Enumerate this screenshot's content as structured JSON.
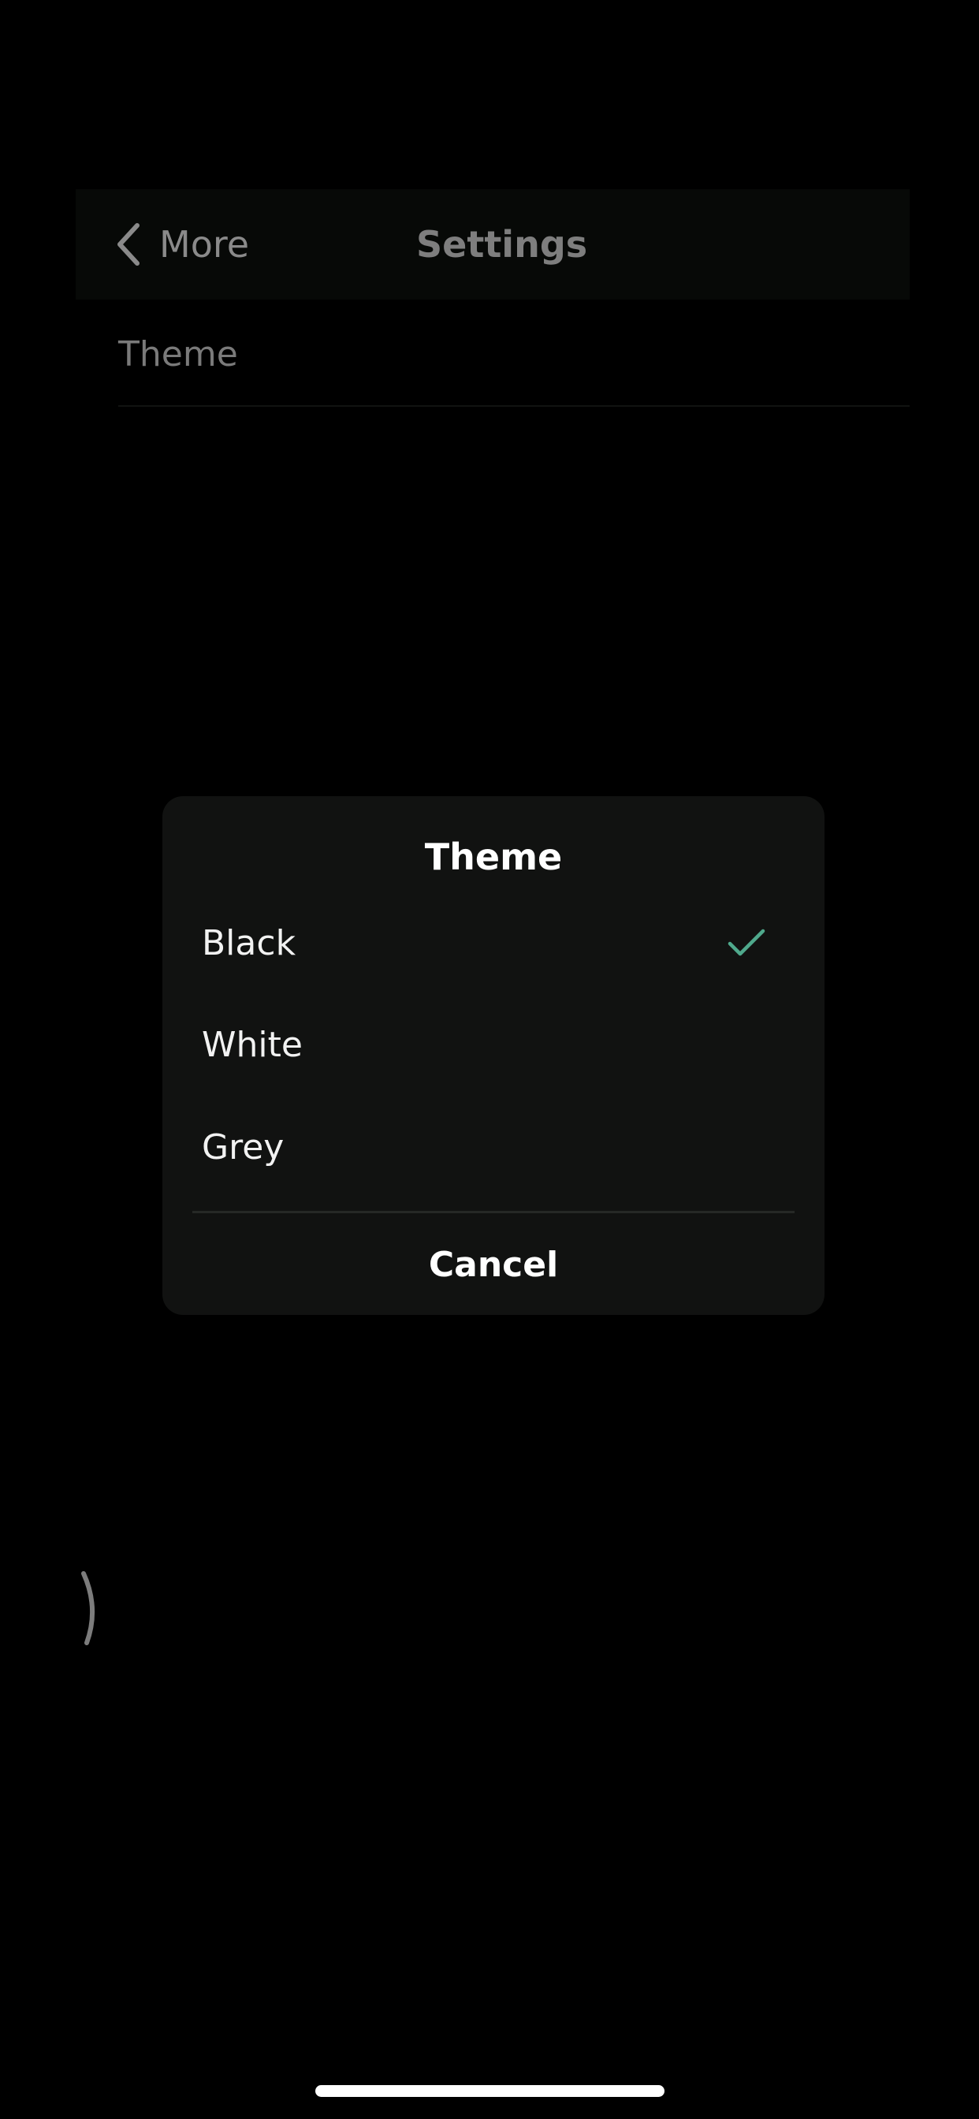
{
  "navbar": {
    "back_label": "More",
    "title": "Settings",
    "back_icon": "chevron-left-icon"
  },
  "settings": {
    "rows": [
      {
        "label": "Theme"
      }
    ]
  },
  "dialog": {
    "title": "Theme",
    "options": [
      {
        "label": "Black",
        "selected": true
      },
      {
        "label": "White",
        "selected": false
      },
      {
        "label": "Grey",
        "selected": false
      }
    ],
    "cancel_label": "Cancel",
    "check_icon": "checkmark-icon"
  },
  "colors": {
    "background": "#000000",
    "dialog_background": "#111211",
    "accent_check": "#4fa98c",
    "text_primary": "#ffffff",
    "text_dimmed": "#8a8a8a"
  }
}
